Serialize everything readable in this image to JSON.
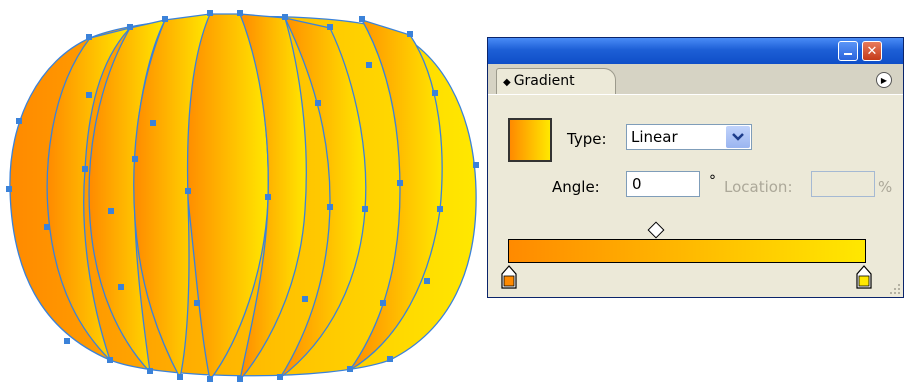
{
  "palette": {
    "tab_label": "Gradient",
    "type_label": "Type:",
    "type_value": "Linear",
    "angle_label": "Angle:",
    "angle_value": "0",
    "degree_symbol": "°",
    "location_label": "Location:",
    "location_value": "",
    "percent_label": "%"
  },
  "colors": {
    "gradient_start": "#ff8a00",
    "gradient_end": "#ffe800",
    "path_stroke": "#3b82d9",
    "titlebar": "#1d5fd6"
  },
  "icons": {
    "minimize": "minimize-icon",
    "close": "close-icon",
    "flyout": "palette-menu-icon",
    "dropdown": "chevron-down-icon"
  }
}
